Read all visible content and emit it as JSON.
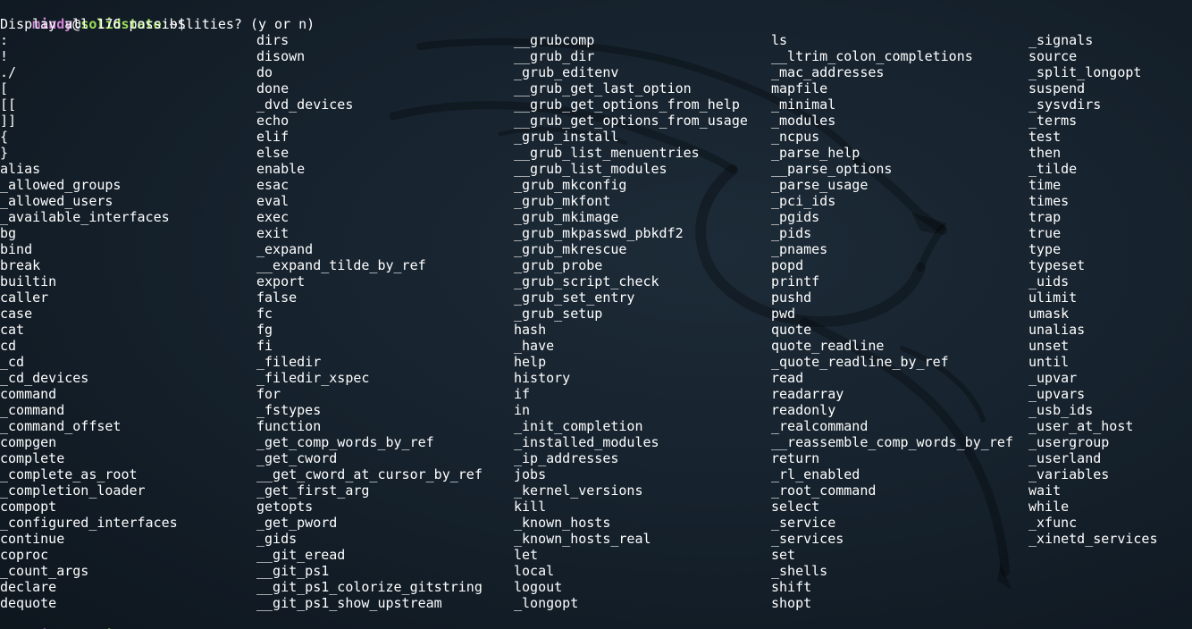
{
  "prompt": {
    "user": "mindy",
    "at": "@",
    "host": "solidstate",
    "suffix": ":~$"
  },
  "question": "Display all 176 possibilities? (y or n)",
  "columns": [
    [
      ":",
      "!",
      "./",
      "[",
      "[[",
      "]]",
      "{",
      "}",
      "alias",
      "_allowed_groups",
      "_allowed_users",
      "_available_interfaces",
      "bg",
      "bind",
      "break",
      "builtin",
      "caller",
      "case",
      "cat",
      "cd",
      "_cd",
      "_cd_devices",
      "command",
      "_command",
      "_command_offset",
      "compgen",
      "complete",
      "_complete_as_root",
      "_completion_loader",
      "compopt",
      "_configured_interfaces",
      "continue",
      "coproc",
      "_count_args",
      "declare",
      "dequote"
    ],
    [
      "dirs",
      "disown",
      "do",
      "done",
      "_dvd_devices",
      "echo",
      "elif",
      "else",
      "enable",
      "esac",
      "eval",
      "exec",
      "exit",
      "_expand",
      "__expand_tilde_by_ref",
      "export",
      "false",
      "fc",
      "fg",
      "fi",
      "_filedir",
      "_filedir_xspec",
      "for",
      "_fstypes",
      "function",
      "_get_comp_words_by_ref",
      "_get_cword",
      "__get_cword_at_cursor_by_ref",
      "_get_first_arg",
      "getopts",
      "_get_pword",
      "_gids",
      "__git_eread",
      "__git_ps1",
      "__git_ps1_colorize_gitstring",
      "__git_ps1_show_upstream"
    ],
    [
      "__grubcomp",
      "__grub_dir",
      "_grub_editenv",
      "__grub_get_last_option",
      "__grub_get_options_from_help",
      "__grub_get_options_from_usage",
      "_grub_install",
      "__grub_list_menuentries",
      "__grub_list_modules",
      "_grub_mkconfig",
      "_grub_mkfont",
      "_grub_mkimage",
      "_grub_mkpasswd_pbkdf2",
      "_grub_mkrescue",
      "_grub_probe",
      "_grub_script_check",
      "_grub_set_entry",
      "_grub_setup",
      "hash",
      "_have",
      "help",
      "history",
      "if",
      "in",
      "_init_completion",
      "_installed_modules",
      "_ip_addresses",
      "jobs",
      "_kernel_versions",
      "kill",
      "_known_hosts",
      "_known_hosts_real",
      "let",
      "local",
      "logout",
      "_longopt"
    ],
    [
      "ls",
      "__ltrim_colon_completions",
      "_mac_addresses",
      "mapfile",
      "_minimal",
      "_modules",
      "_ncpus",
      "_parse_help",
      "__parse_options",
      "_parse_usage",
      "_pci_ids",
      "_pgids",
      "_pids",
      "_pnames",
      "popd",
      "printf",
      "pushd",
      "pwd",
      "quote",
      "quote_readline",
      "_quote_readline_by_ref",
      "read",
      "readarray",
      "readonly",
      "_realcommand",
      "__reassemble_comp_words_by_ref",
      "return",
      "_rl_enabled",
      "_root_command",
      "select",
      "_service",
      "_services",
      "set",
      "_shells",
      "shift",
      "shopt"
    ],
    [
      "_signals",
      "source",
      "_split_longopt",
      "suspend",
      "_sysvdirs",
      "_terms",
      "test",
      "then",
      "_tilde",
      "time",
      "times",
      "trap",
      "true",
      "type",
      "typeset",
      "_uids",
      "ulimit",
      "umask",
      "unalias",
      "unset",
      "until",
      "_upvar",
      "_upvars",
      "_usb_ids",
      "_user_at_host",
      "_usergroup",
      "_userland",
      "_variables",
      "wait",
      "while",
      "_xfunc",
      "_xinetd_services"
    ]
  ],
  "icons": {
    "background": "kali-dragon-logo-icon"
  },
  "colors": {
    "background": "#16222d",
    "user": "#cf83d6",
    "host": "#9fe05a",
    "text": "#ffffff"
  }
}
